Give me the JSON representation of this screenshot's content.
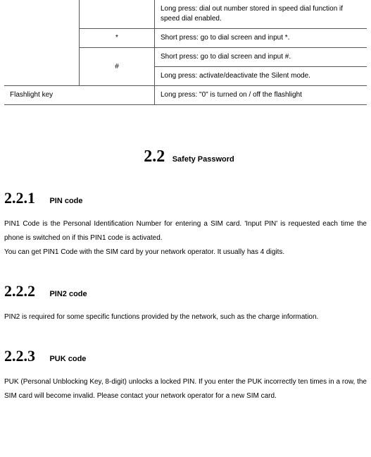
{
  "table": {
    "r1c3": "Long press: dial out number stored in speed dial function if speed dial enabled.",
    "r2c2": "*",
    "r2c3": "Short press: go to dial screen and input *.",
    "r3c2": "#",
    "r3c3": "Short press: go to dial screen and input #.",
    "r4c3": "Long press: activate/deactivate the Silent mode.",
    "r5c1": "Flashlight key",
    "r5c3": "Long press: \"0\" is turned on / off the flashlight"
  },
  "section": {
    "num": "2.2",
    "title": "Safety Password"
  },
  "sub1": {
    "num": "2.2.1",
    "title": "PIN code",
    "p1": "PIN1 Code is the Personal Identification Number for entering a SIM card. 'Input PIN' is requested each time the phone is switched on if this PIN1 code is activated.",
    "p2": "You can get PIN1 Code with the SIM card by your network operator. It usually has 4 digits."
  },
  "sub2": {
    "num": "2.2.2",
    "title": "PIN2 code",
    "p1": "PIN2 is required for some specific functions provided by the network, such as the charge information."
  },
  "sub3": {
    "num": "2.2.3",
    "title": "PUK code",
    "p1": "PUK (Personal Unblocking Key, 8-digit) unlocks a locked PIN. If you enter the PUK incorrectly ten times in a row, the SIM card will become invalid. Please contact your network operator for a new SIM card."
  }
}
